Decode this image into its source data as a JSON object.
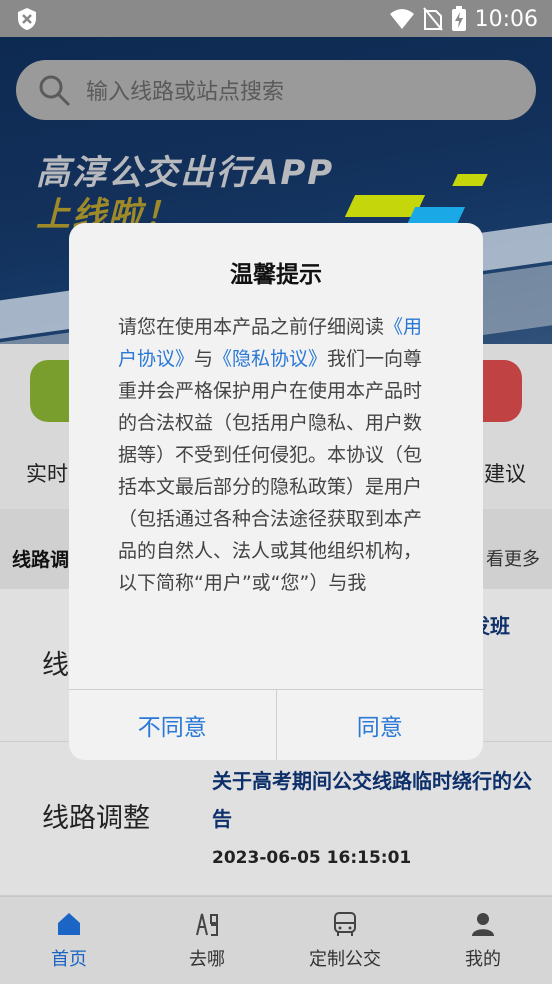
{
  "status_bar": {
    "time": "10:06"
  },
  "search": {
    "placeholder": "输入线路或站点搜索"
  },
  "banner": {
    "title": "高淳公交出行APP",
    "subtitle": "上线啦！"
  },
  "quick_menu": {
    "left_label": "实时",
    "right_label": "建议"
  },
  "section": {
    "title": "线路调",
    "more": "看更多"
  },
  "news": [
    {
      "tag": "线",
      "title": "发班",
      "date": ""
    },
    {
      "tag": "线路调整",
      "title": "关于高考期间公交线路临时绕行的公告",
      "date": "2023-06-05 16:15:01"
    }
  ],
  "tabs": [
    {
      "label": "首页",
      "icon": "home-icon",
      "active": true
    },
    {
      "label": "去哪",
      "icon": "route-icon",
      "active": false
    },
    {
      "label": "定制公交",
      "icon": "bus-icon",
      "active": false
    },
    {
      "label": "我的",
      "icon": "user-icon",
      "active": false
    }
  ],
  "dialog": {
    "title": "温馨提示",
    "body_intro": "请您在使用本产品之前仔细阅读",
    "link_user_agreement": "《用户协议》",
    "and": "与",
    "link_privacy": "《隐私协议》",
    "body_rest": "我们一向尊重并会严格保护用户在使用本产品时的合法权益（包括用户隐私、用户数据等）不受到任何侵犯。本协议（包括本文最后部分的隐私政策）是用户（包括通过各种合法途径获取到本产品的自然人、法人或其他组织机构，以下简称“用户”或“您”）与我",
    "disagree": "不同意",
    "agree": "同意"
  },
  "colors": {
    "accent": "#2a78d6",
    "tab_active": "#1b65c4",
    "news_title": "#0d2f6a"
  }
}
